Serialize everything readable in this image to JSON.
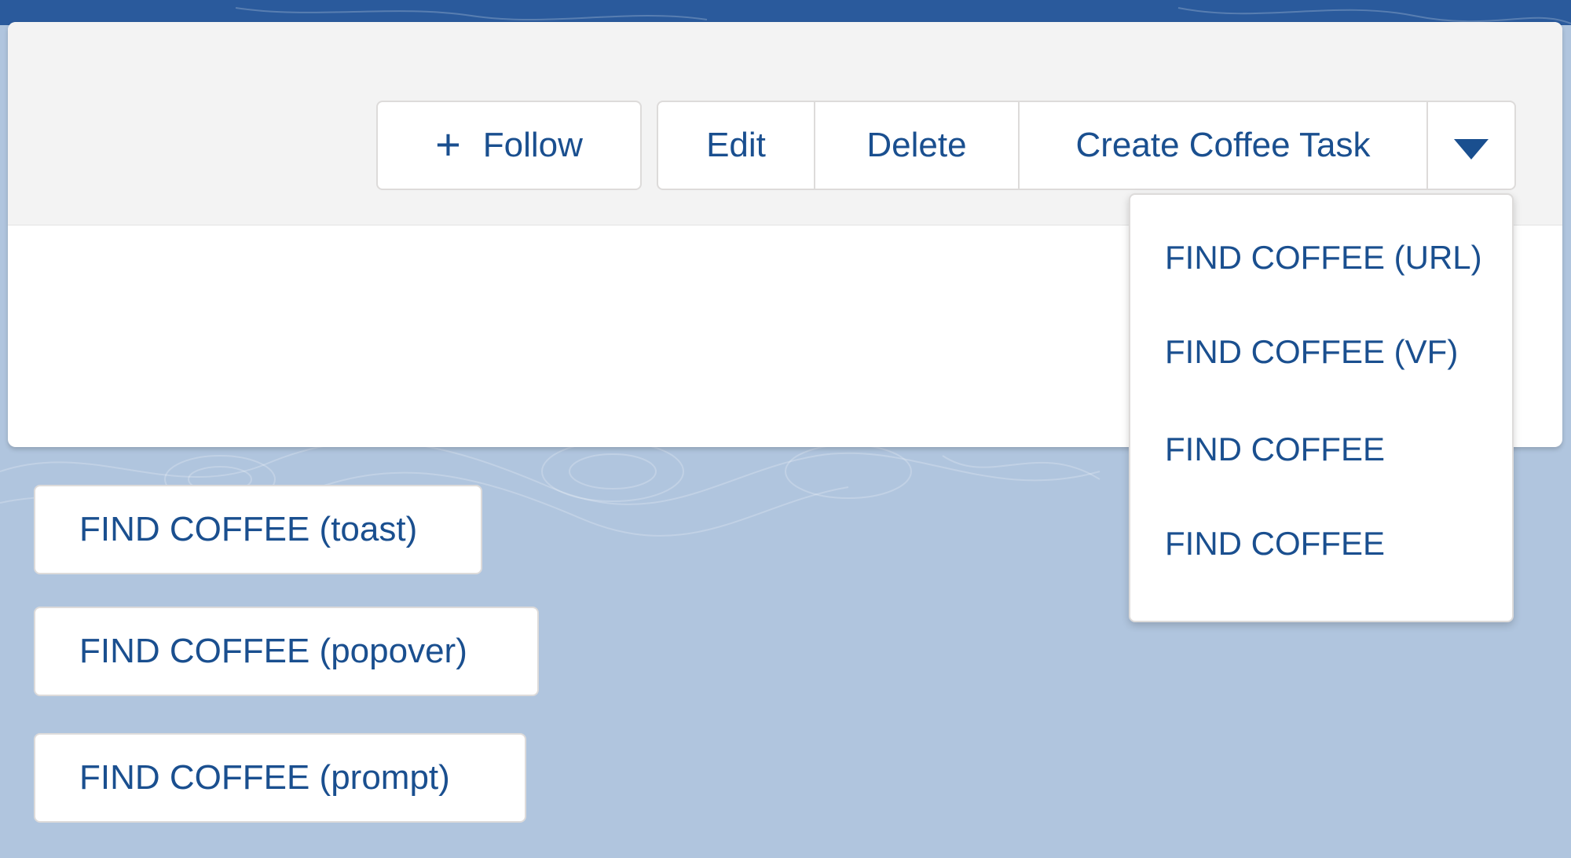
{
  "header": {
    "follow_label": "Follow",
    "actions": {
      "edit": "Edit",
      "delete": "Delete",
      "create_coffee_task": "Create Coffee Task"
    }
  },
  "dropdown_menu": {
    "items": [
      "FIND COFFEE (URL)",
      "FIND COFFEE (VF)",
      "FIND COFFEE",
      "FIND COFFEE"
    ]
  },
  "quick_actions": [
    "FIND COFFEE (toast)",
    "FIND COFFEE (popover)",
    "FIND COFFEE (prompt)"
  ],
  "colors": {
    "background": "#b0c5de",
    "top_band": "#2a5a9c",
    "link_text": "#1a4f8f",
    "button_border": "#dddbda",
    "header_bg": "#f3f3f3"
  },
  "icons": {
    "follow": "plus-icon",
    "more_actions": "caret-down-icon"
  }
}
